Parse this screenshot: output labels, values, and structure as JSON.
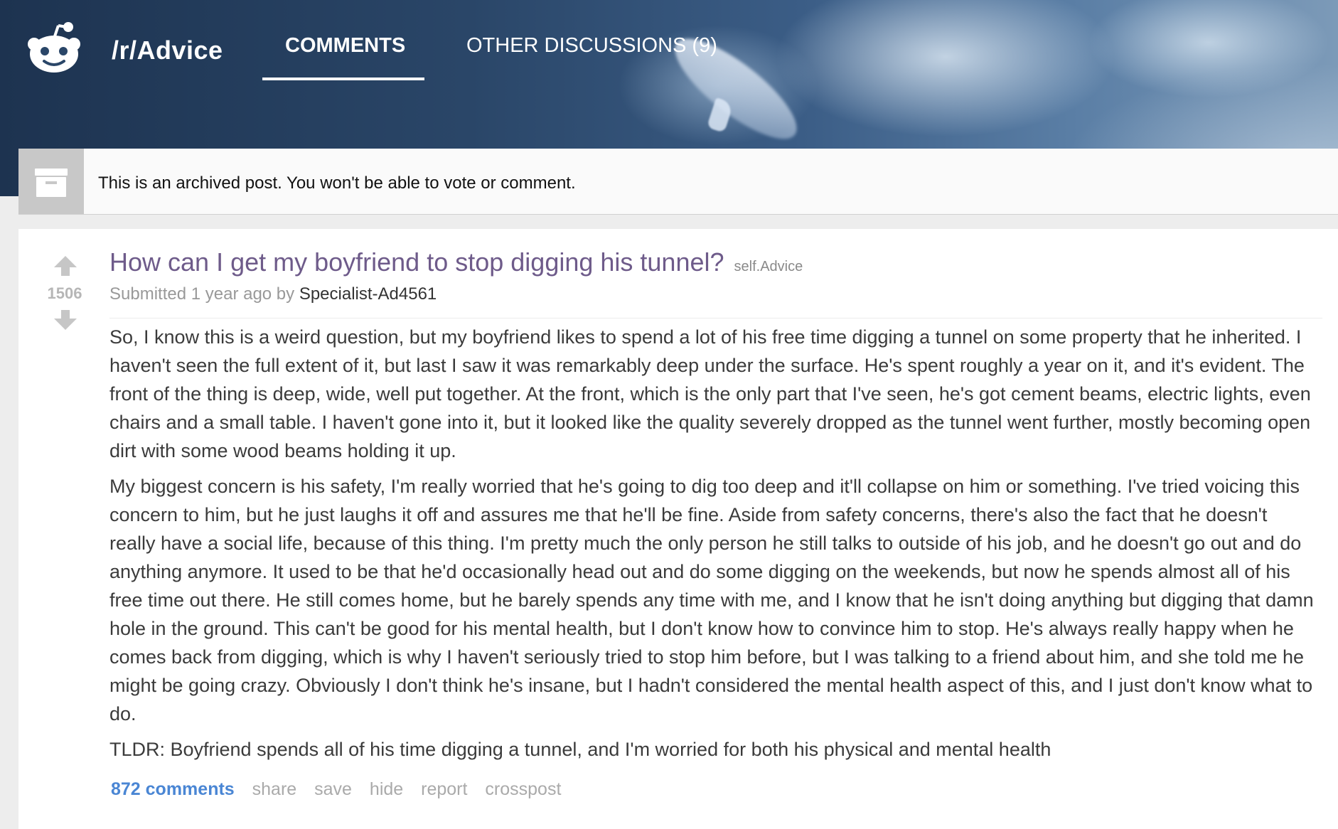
{
  "header": {
    "subreddit": "/r/Advice",
    "tabs": [
      {
        "label": "COMMENTS",
        "active": true
      },
      {
        "label": "OTHER DISCUSSIONS (9)",
        "active": false
      }
    ],
    "logo_icon": "reddit-alien-icon"
  },
  "archive_notice": {
    "icon": "archive-box-icon",
    "text": "This is an archived post. You won't be able to vote or comment."
  },
  "post": {
    "score": "1506",
    "title": "How can I get my boyfriend to stop digging his tunnel?",
    "domain": "self.Advice",
    "submitted_prefix": "Submitted 1 year ago by",
    "author": "Specialist-Ad4561",
    "paragraphs": [
      "So, I know this is a weird question, but my boyfriend likes to spend a lot of his free time digging a tunnel on some property that he inherited. I haven't seen the full extent of it, but last I saw it was remarkably deep under the surface. He's spent roughly a year on it, and it's evident. The front of the thing is deep, wide, well put together. At the front, which is the only part that I've seen, he's got cement beams, electric lights, even chairs and a small table. I haven't gone into it, but it looked like the quality severely dropped as the tunnel went further, mostly becoming open dirt with some wood beams holding it up.",
      "My biggest concern is his safety, I'm really worried that he's going to dig too deep and it'll collapse on him or something. I've tried voicing this concern to him, but he just laughs it off and assures me that he'll be fine. Aside from safety concerns, there's also the fact that he doesn't really have a social life, because of this thing. I'm pretty much the only person he still talks to outside of his job, and he doesn't go out and do anything anymore. It used to be that he'd occasionally head out and do some digging on the weekends, but now he spends almost all of his free time out there. He still comes home, but he barely spends any time with me, and I know that he isn't doing anything but digging that damn hole in the ground. This can't be good for his mental health, but I don't know how to convince him to stop. He's always really happy when he comes back from digging, which is why I haven't seriously tried to stop him before, but I was talking to a friend about him, and she told me he might be going crazy. Obviously I don't think he's insane, but I hadn't considered the mental health aspect of this, and I just don't know what to do.",
      "TLDR: Boyfriend spends all of his time digging a tunnel, and I'm worried for both his physical and mental health"
    ],
    "actions": {
      "comments": "872 comments",
      "share": "share",
      "save": "save",
      "hide": "hide",
      "report": "report",
      "crosspost": "crosspost"
    }
  },
  "colors": {
    "title": "#6e5b8a",
    "comments_link": "#4a86d4",
    "score": "#b6b6b6"
  }
}
